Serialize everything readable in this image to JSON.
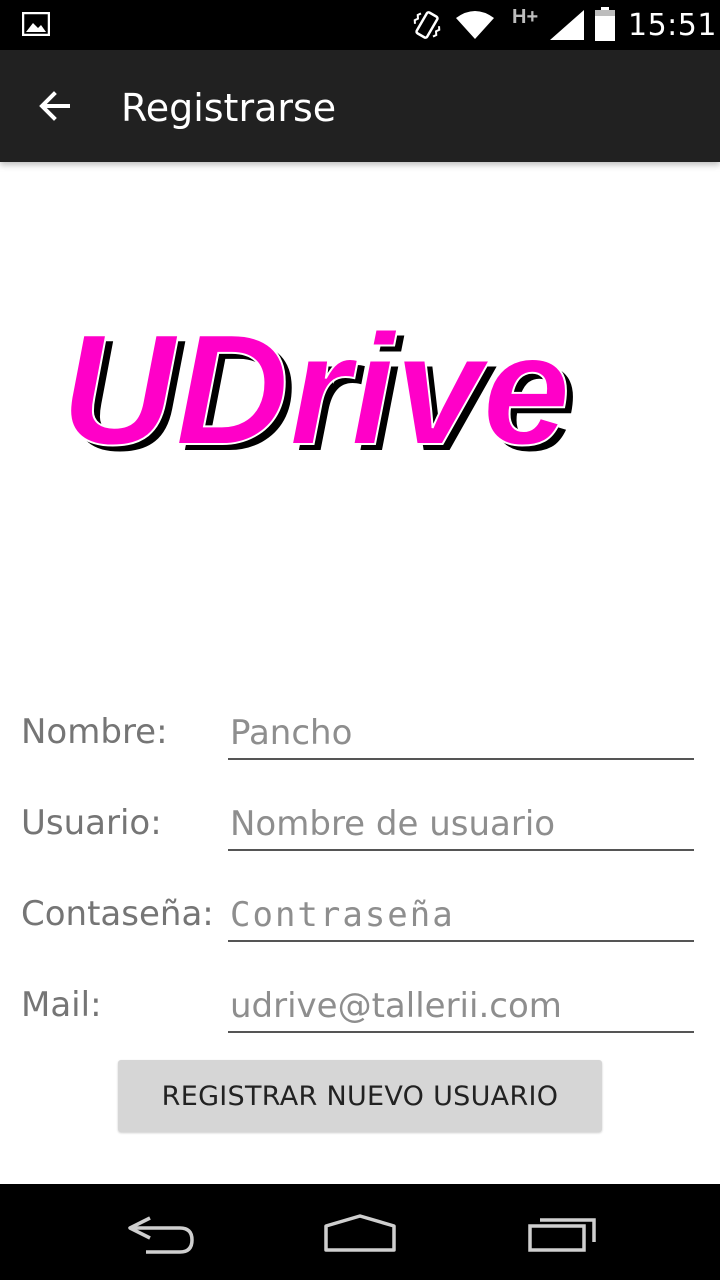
{
  "status_bar": {
    "time": "15:51",
    "network_type": "H+",
    "icons": [
      "gallery-icon",
      "vibrate-icon",
      "wifi-icon",
      "signal-icon",
      "battery-icon"
    ]
  },
  "action_bar": {
    "title": "Registrarse",
    "back_icon": "arrow-back-icon"
  },
  "logo": {
    "text": "UDrive",
    "color": "#ff00c8",
    "shadow_color": "#000000"
  },
  "form": {
    "nombre": {
      "label": "Nombre:",
      "value": "Pancho",
      "placeholder": ""
    },
    "usuario": {
      "label": "Usuario:",
      "value": "",
      "placeholder": "Nombre de usuario"
    },
    "contrasena": {
      "label": "Contaseña:",
      "value": "",
      "placeholder": "Contraseña"
    },
    "mail": {
      "label": "Mail:",
      "value": "udrive@tallerii.com",
      "placeholder": ""
    }
  },
  "register_button": {
    "label": "REGISTRAR NUEVO USUARIO"
  },
  "nav_bar": {
    "icons": [
      "nav-back-icon",
      "nav-home-icon",
      "nav-recents-icon"
    ]
  },
  "colors": {
    "status_bar": "#000000",
    "action_bar": "#212121",
    "brand": "#ff00c8",
    "button": "#d6d6d6"
  }
}
